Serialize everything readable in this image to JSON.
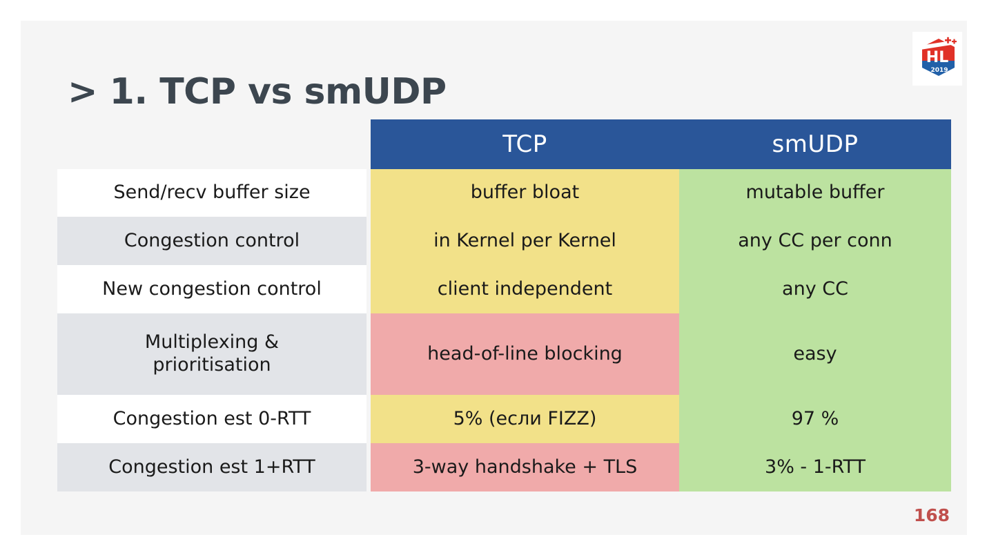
{
  "slide": {
    "title": "> 1. TCP vs smUDP",
    "page_number": "168",
    "background_color": "#f5f5f5",
    "title_color": "#3c464f",
    "page_number_color": "#c0504d"
  },
  "logo": {
    "name": "highload-2019-badge",
    "text_main": "HL",
    "text_year": "2019",
    "color_red": "#e03127",
    "color_blue": "#2160a8",
    "color_plus": "#e03127"
  },
  "table": {
    "header": {
      "blank": "",
      "col_tcp": "TCP",
      "col_smudp": "smUDP",
      "background_color": "#2a5699",
      "text_color": "#ffffff"
    },
    "colors": {
      "yellow": "#f2e189",
      "pink": "#f0aaaa",
      "green": "#bce2a0",
      "row_white": "#ffffff",
      "row_gray": "#e2e4e8"
    },
    "rows": [
      {
        "label": "Send/recv buffer size",
        "label_line2": "",
        "tcp": "buffer bloat",
        "smudp": "mutable buffer",
        "tcp_color": "yellow",
        "smudp_color": "green",
        "row_shade": "white"
      },
      {
        "label": "Congestion control",
        "label_line2": "",
        "tcp": "in Kernel per Kernel",
        "smudp": "any CC per conn",
        "tcp_color": "yellow",
        "smudp_color": "green",
        "row_shade": "gray"
      },
      {
        "label": "New congestion control",
        "label_line2": "",
        "tcp": "client independent",
        "smudp": "any CC",
        "tcp_color": "yellow",
        "smudp_color": "green",
        "row_shade": "white"
      },
      {
        "label": "Multiplexing &",
        "label_line2": "prioritisation",
        "tcp": "head-of-line blocking",
        "smudp": "easy",
        "tcp_color": "pink",
        "smudp_color": "green",
        "row_shade": "gray"
      },
      {
        "label": "Congestion est 0-RTT",
        "label_line2": "",
        "tcp": "5% (если FIZZ)",
        "smudp": "97 %",
        "tcp_color": "yellow",
        "smudp_color": "green",
        "row_shade": "white"
      },
      {
        "label": "Congestion est 1+RTT",
        "label_line2": "",
        "tcp": "3-way handshake + TLS",
        "smudp": "3% - 1-RTT",
        "tcp_color": "pink",
        "smudp_color": "green",
        "row_shade": "gray"
      }
    ]
  }
}
